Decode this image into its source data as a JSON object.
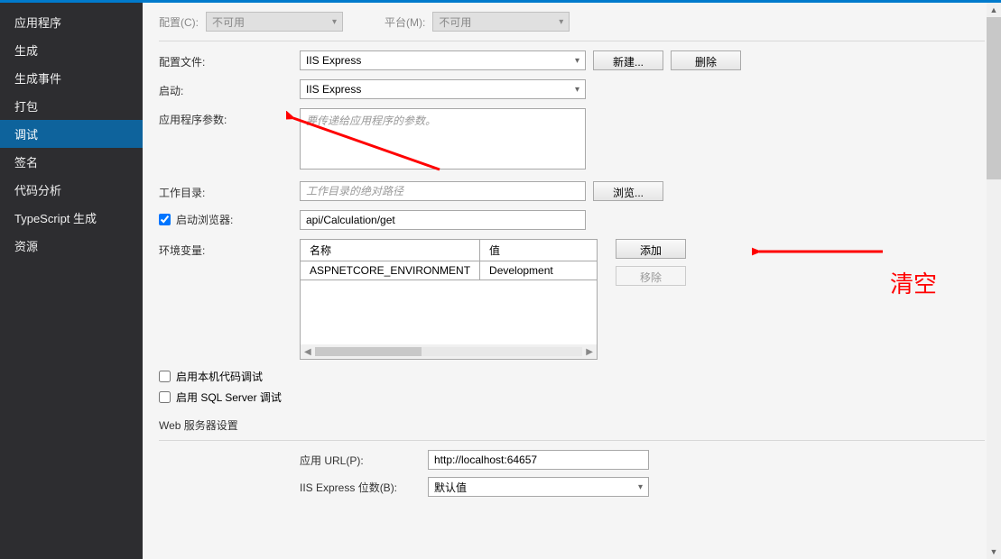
{
  "sidebar": {
    "items": [
      {
        "label": "应用程序"
      },
      {
        "label": "生成"
      },
      {
        "label": "生成事件"
      },
      {
        "label": "打包"
      },
      {
        "label": "调试",
        "selected": true
      },
      {
        "label": "签名"
      },
      {
        "label": "代码分析"
      },
      {
        "label": "TypeScript 生成"
      },
      {
        "label": "资源"
      }
    ]
  },
  "top": {
    "config_label": "配置(C):",
    "config_value": "不可用",
    "platform_label": "平台(M):",
    "platform_value": "不可用"
  },
  "form": {
    "profile_label": "配置文件:",
    "profile_value": "IIS Express",
    "new_btn": "新建...",
    "delete_btn": "删除",
    "launch_label": "启动:",
    "launch_value": "IIS Express",
    "args_label": "应用程序参数:",
    "args_placeholder": "要传递给应用程序的参数。",
    "workdir_label": "工作目录:",
    "workdir_placeholder": "工作目录的绝对路径",
    "browse_btn": "浏览...",
    "launch_browser_label": "启动浏览器:",
    "launch_browser_value": "api/Calculation/get",
    "env_label": "环境变量:",
    "env_col_name": "名称",
    "env_col_value": "值",
    "env_rows": [
      {
        "name": "ASPNETCORE_ENVIRONMENT",
        "value": "Development"
      }
    ],
    "add_btn": "添加",
    "remove_btn": "移除",
    "native_debug": "启用本机代码调试",
    "sql_debug": "启用 SQL Server 调试",
    "web_section": "Web 服务器设置",
    "app_url_label": "应用 URL(P):",
    "app_url_value": "http://localhost:64657",
    "iis_bits_label": "IIS Express 位数(B):",
    "iis_bits_value": "默认值"
  },
  "annotation": "清空"
}
